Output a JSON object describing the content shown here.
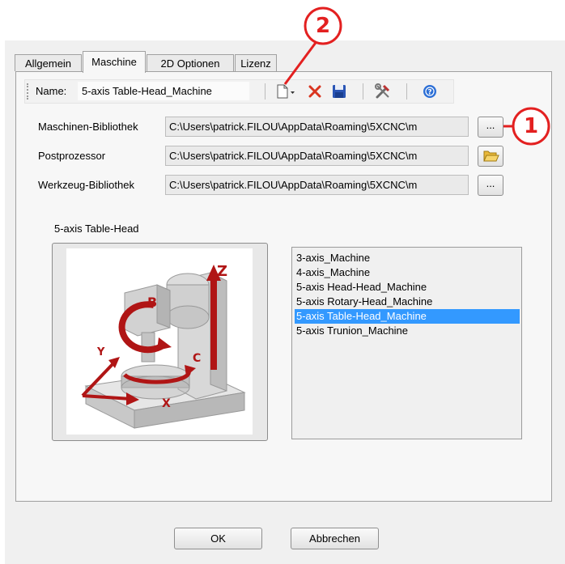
{
  "tabs": [
    {
      "label": "Allgemein"
    },
    {
      "label": "Maschine"
    },
    {
      "label": "2D Optionen"
    },
    {
      "label": "Lizenz"
    }
  ],
  "toolbar": {
    "name_label": "Name:",
    "name_value": "5-axis Table-Head_Machine"
  },
  "paths": {
    "machine_library_label": "Maschinen-Bibliothek",
    "machine_library_value": "C:\\Users\\patrick.FILOU\\AppData\\Roaming\\5XCNC\\m",
    "machine_library_browse": "...",
    "postprocessor_label": "Postprozessor",
    "postprocessor_value": "C:\\Users\\patrick.FILOU\\AppData\\Roaming\\5XCNC\\m",
    "tool_library_label": "Werkzeug-Bibliothek",
    "tool_library_value": "C:\\Users\\patrick.FILOU\\AppData\\Roaming\\5XCNC\\m",
    "tool_library_browse": "..."
  },
  "machine": {
    "preview_title": "5-axis Table-Head",
    "axis_labels": {
      "z": "Z",
      "b": "B",
      "c": "C",
      "x": "X",
      "y": "Y"
    },
    "list": [
      "3-axis_Machine",
      "4-axis_Machine",
      "5-axis Head-Head_Machine",
      "5-axis Rotary-Head_Machine",
      "5-axis Table-Head_Machine",
      "5-axis Trunion_Machine"
    ],
    "selected": "5-axis Table-Head_Machine"
  },
  "buttons": {
    "ok": "OK",
    "cancel": "Abbrechen"
  },
  "annotations": {
    "marker1": "1",
    "marker2": "2"
  },
  "colors": {
    "accent": "#e32020",
    "selection": "#3399ff",
    "machine_red": "#b01515"
  }
}
